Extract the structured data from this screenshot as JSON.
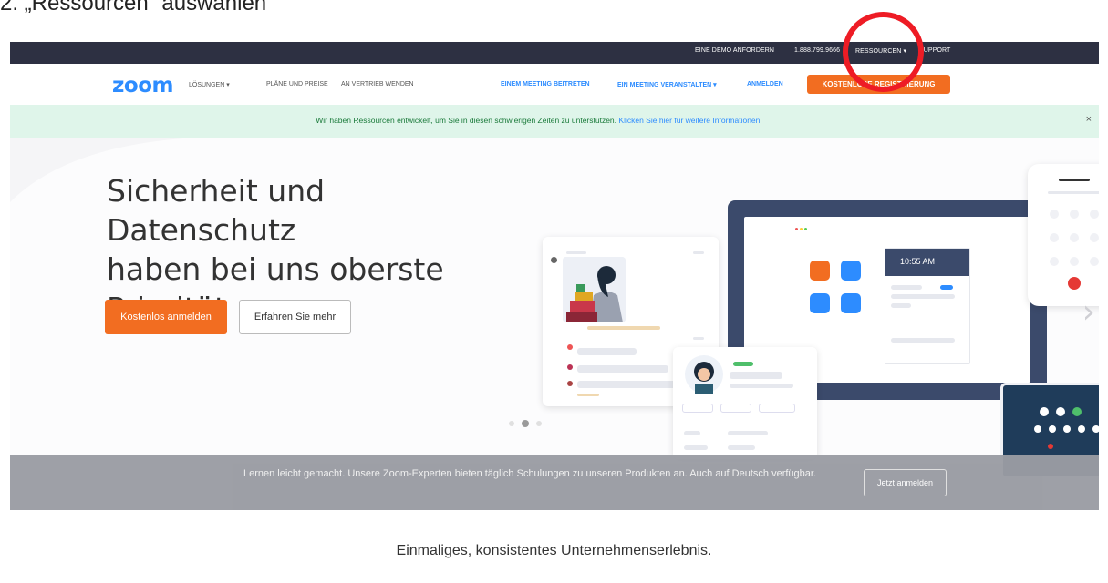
{
  "caption": "2.  „Ressourcen“ auswählen",
  "topbar": {
    "demo": "EINE DEMO ANFORDERN",
    "phone": "1.888.799.9666",
    "resources": "RESSOURCEN ▾",
    "support": "SUPPORT"
  },
  "nav": {
    "logo": "zoom",
    "solutions": "LÖSUNGEN ▾",
    "plans": "PLÄNE UND PREISE",
    "sales": "AN VERTRIEB WENDEN",
    "join": "EINEM MEETING BEITRETEN",
    "host": "EIN MEETING VERANSTALTEN ▾",
    "signin": "ANMELDEN",
    "register": "KOSTENLOSE REGISTRIERUNG"
  },
  "banner": {
    "text": "Wir haben Ressourcen entwickelt, um Sie in diesen schwierigen Zeiten zu unterstützen.",
    "link": "Klicken Sie hier für weitere Informationen.",
    "close": "×"
  },
  "hero": {
    "title_line1": "Sicherheit und Datenschutz",
    "title_line2": "haben bei uns oberste",
    "title_line3": "Priorität",
    "primary_btn": "Kostenlos anmelden",
    "secondary_btn": "Erfahren Sie mehr",
    "clock": "10:55 AM",
    "next_arrow": "›"
  },
  "training": {
    "text": "Lernen leicht gemacht. Unsere Zoom-Experten bieten täglich Schulungen zu unseren Produkten an. Auch auf Deutsch verfügbar.",
    "button": "Jetzt anmelden"
  },
  "section": {
    "title": "Einmaliges, konsistentes Unternehmenserlebnis."
  },
  "colors": {
    "brand_blue": "#2d8cff",
    "orange": "#f26d21",
    "topbar": "#2d3042",
    "banner_bg": "#dff5ea",
    "highlight_red": "#ee1c25"
  }
}
